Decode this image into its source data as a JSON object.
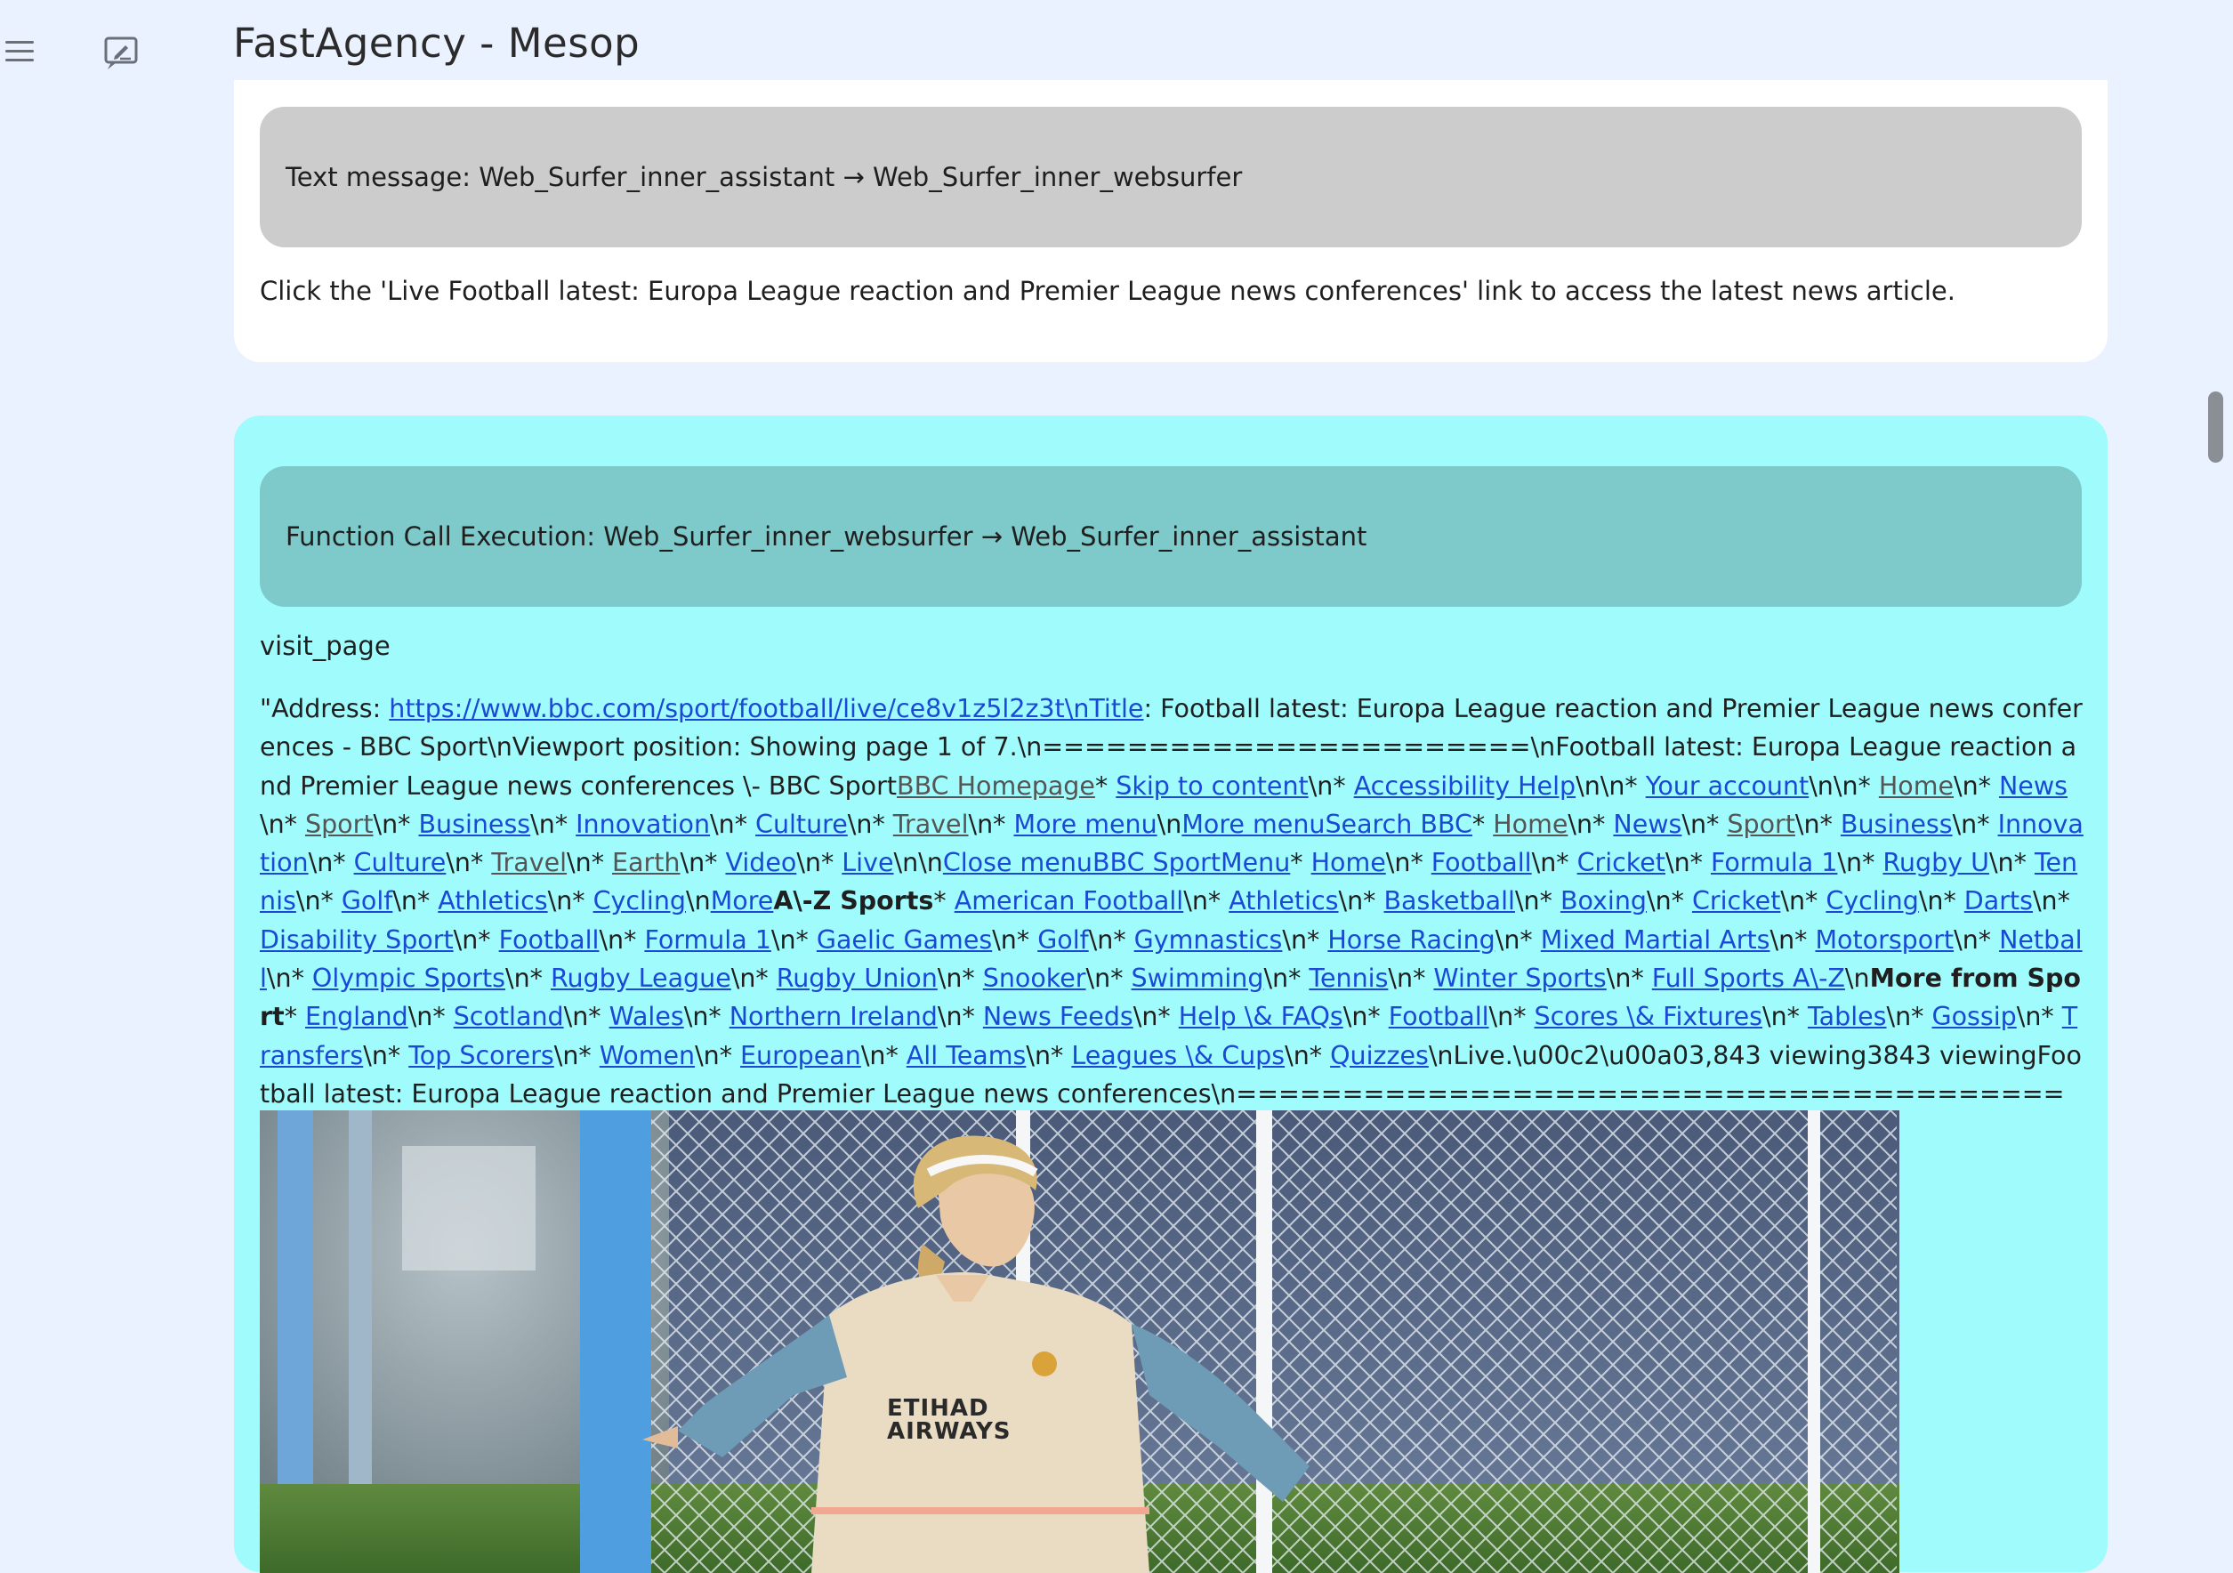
{
  "app": {
    "title": "FastAgency - Mesop"
  },
  "message_card": {
    "header": "Text message: Web_Surfer_inner_assistant → Web_Surfer_inner_websurfer",
    "body": "Click the 'Live Football latest: Europa League reaction and Premier League news conferences' link to access the latest news article."
  },
  "function_card": {
    "header": "Function Call Execution: Web_Surfer_inner_websurfer → Web_Surfer_inner_assistant",
    "function_name": "visit_page",
    "segments": [
      {
        "t": "\"Address: "
      },
      {
        "t": "https://www.bbc.com/sport/football/live/ce8v1z5l2z3t\\nTitle",
        "link": true
      },
      {
        "t": ": Football latest: Europa League reaction and Premier League news conferences - BBC Sport\\nViewport position: Showing page 1 of 7.\\n=======================\\nFootball latest: Europa League reaction and Premier League news conferences \\- BBC Sport"
      },
      {
        "t": "BBC Homepage",
        "link": true,
        "gray": true
      },
      {
        "t": "* "
      },
      {
        "t": "Skip to content",
        "link": true
      },
      {
        "t": "\\n* "
      },
      {
        "t": "Accessibility Help",
        "link": true
      },
      {
        "t": "\\n\\n* "
      },
      {
        "t": "Your account",
        "link": true
      },
      {
        "t": "\\n\\n* "
      },
      {
        "t": "Home",
        "link": true,
        "gray": true
      },
      {
        "t": "\\n* "
      },
      {
        "t": "News",
        "link": true
      },
      {
        "t": "\\n* "
      },
      {
        "t": "Sport",
        "link": true,
        "gray": true
      },
      {
        "t": "\\n* "
      },
      {
        "t": "Business",
        "link": true
      },
      {
        "t": "\\n* "
      },
      {
        "t": "Innovation",
        "link": true
      },
      {
        "t": "\\n* "
      },
      {
        "t": "Culture",
        "link": true
      },
      {
        "t": "\\n* "
      },
      {
        "t": "Travel",
        "link": true,
        "gray": true
      },
      {
        "t": "\\n* "
      },
      {
        "t": "More menu",
        "link": true
      },
      {
        "t": "\\n"
      },
      {
        "t": "More menuSearch BBC",
        "link": true
      },
      {
        "t": "* "
      },
      {
        "t": "Home",
        "link": true,
        "gray": true
      },
      {
        "t": "\\n* "
      },
      {
        "t": "News",
        "link": true
      },
      {
        "t": "\\n* "
      },
      {
        "t": "Sport",
        "link": true,
        "gray": true
      },
      {
        "t": "\\n* "
      },
      {
        "t": "Business",
        "link": true
      },
      {
        "t": "\\n* "
      },
      {
        "t": "Innovation",
        "link": true
      },
      {
        "t": "\\n* "
      },
      {
        "t": "Culture",
        "link": true
      },
      {
        "t": "\\n* "
      },
      {
        "t": "Travel",
        "link": true,
        "gray": true
      },
      {
        "t": "\\n* "
      },
      {
        "t": "Earth",
        "link": true,
        "gray": true
      },
      {
        "t": "\\n* "
      },
      {
        "t": "Video",
        "link": true
      },
      {
        "t": "\\n* "
      },
      {
        "t": "Live",
        "link": true
      },
      {
        "t": "\\n\\n"
      },
      {
        "t": "Close menuBBC SportMenu",
        "link": true
      },
      {
        "t": "* "
      },
      {
        "t": "Home",
        "link": true
      },
      {
        "t": "\\n* "
      },
      {
        "t": "Football",
        "link": true
      },
      {
        "t": "\\n* "
      },
      {
        "t": "Cricket",
        "link": true
      },
      {
        "t": "\\n* "
      },
      {
        "t": "Formula 1",
        "link": true
      },
      {
        "t": "\\n* "
      },
      {
        "t": "Rugby U",
        "link": true
      },
      {
        "t": "\\n* "
      },
      {
        "t": "Tennis",
        "link": true
      },
      {
        "t": "\\n* "
      },
      {
        "t": "Golf",
        "link": true
      },
      {
        "t": "\\n* "
      },
      {
        "t": "Athletics",
        "link": true
      },
      {
        "t": "\\n* "
      },
      {
        "t": "Cycling",
        "link": true
      },
      {
        "t": "\\n"
      },
      {
        "t": "More",
        "link": true
      },
      {
        "t": "A\\-Z Sports",
        "bold": true
      },
      {
        "t": "* "
      },
      {
        "t": "American Football",
        "link": true
      },
      {
        "t": "\\n* "
      },
      {
        "t": "Athletics",
        "link": true
      },
      {
        "t": "\\n* "
      },
      {
        "t": "Basketball",
        "link": true
      },
      {
        "t": "\\n* "
      },
      {
        "t": "Boxing",
        "link": true
      },
      {
        "t": "\\n* "
      },
      {
        "t": "Cricket",
        "link": true
      },
      {
        "t": "\\n* "
      },
      {
        "t": "Cycling",
        "link": true
      },
      {
        "t": "\\n* "
      },
      {
        "t": "Darts",
        "link": true
      },
      {
        "t": "\\n* "
      },
      {
        "t": "Disability Sport",
        "link": true
      },
      {
        "t": "\\n* "
      },
      {
        "t": "Football",
        "link": true
      },
      {
        "t": "\\n* "
      },
      {
        "t": "Formula 1",
        "link": true
      },
      {
        "t": "\\n* "
      },
      {
        "t": "Gaelic Games",
        "link": true
      },
      {
        "t": "\\n* "
      },
      {
        "t": "Golf",
        "link": true
      },
      {
        "t": "\\n* "
      },
      {
        "t": "Gymnastics",
        "link": true
      },
      {
        "t": "\\n* "
      },
      {
        "t": "Horse Racing",
        "link": true
      },
      {
        "t": "\\n* "
      },
      {
        "t": "Mixed Martial Arts",
        "link": true
      },
      {
        "t": "\\n* "
      },
      {
        "t": "Motorsport",
        "link": true
      },
      {
        "t": "\\n* "
      },
      {
        "t": "Netball",
        "link": true
      },
      {
        "t": "\\n* "
      },
      {
        "t": "Olympic Sports",
        "link": true
      },
      {
        "t": "\\n* "
      },
      {
        "t": "Rugby League",
        "link": true
      },
      {
        "t": "\\n* "
      },
      {
        "t": "Rugby Union",
        "link": true
      },
      {
        "t": "\\n* "
      },
      {
        "t": "Snooker",
        "link": true
      },
      {
        "t": "\\n* "
      },
      {
        "t": "Swimming",
        "link": true
      },
      {
        "t": "\\n* "
      },
      {
        "t": "Tennis",
        "link": true
      },
      {
        "t": "\\n* "
      },
      {
        "t": "Winter Sports",
        "link": true
      },
      {
        "t": "\\n* "
      },
      {
        "t": "Full Sports A\\-Z",
        "link": true
      },
      {
        "t": "\\n"
      },
      {
        "t": "More from Sport",
        "bold": true
      },
      {
        "t": "* "
      },
      {
        "t": "England",
        "link": true
      },
      {
        "t": "\\n* "
      },
      {
        "t": "Scotland",
        "link": true
      },
      {
        "t": "\\n* "
      },
      {
        "t": "Wales",
        "link": true
      },
      {
        "t": "\\n* "
      },
      {
        "t": "Northern Ireland",
        "link": true
      },
      {
        "t": "\\n* "
      },
      {
        "t": "News Feeds",
        "link": true
      },
      {
        "t": "\\n* "
      },
      {
        "t": "Help \\& FAQs",
        "link": true
      },
      {
        "t": "\\n* "
      },
      {
        "t": "Football",
        "link": true
      },
      {
        "t": "\\n* "
      },
      {
        "t": "Scores \\& Fixtures",
        "link": true
      },
      {
        "t": "\\n* "
      },
      {
        "t": "Tables",
        "link": true
      },
      {
        "t": "\\n* "
      },
      {
        "t": "Gossip",
        "link": true
      },
      {
        "t": "\\n* "
      },
      {
        "t": "Transfers",
        "link": true
      },
      {
        "t": "\\n* "
      },
      {
        "t": "Top Scorers",
        "link": true
      },
      {
        "t": "\\n* "
      },
      {
        "t": "Women",
        "link": true
      },
      {
        "t": "\\n* "
      },
      {
        "t": "European",
        "link": true
      },
      {
        "t": "\\n* "
      },
      {
        "t": "All Teams",
        "link": true
      },
      {
        "t": "\\n* "
      },
      {
        "t": "Leagues \\& Cups",
        "link": true
      },
      {
        "t": "\\n* "
      },
      {
        "t": "Quizzes",
        "link": true
      },
      {
        "t": "\\nLive.\\u00c2\\u00a03,843 viewing3843 viewingFootball latest: Europa League reaction and Premier League news conferences\\n========================================================================\\n\\n"
      }
    ],
    "image_alt": "Footballer in Etihad Airways kit celebrating in front of a goal net",
    "image_text": "ETIHAD AIRWAYS"
  },
  "colors": {
    "page_bg": "#eaf1ff",
    "card_bg": "#ffffff",
    "message_header": "#cccccc",
    "function_card_bg": "#a0fcfc",
    "function_header": "#7ecaca",
    "link": "#1a49d6"
  },
  "icons": [
    "hamburger-menu-icon",
    "edit-chat-icon"
  ]
}
